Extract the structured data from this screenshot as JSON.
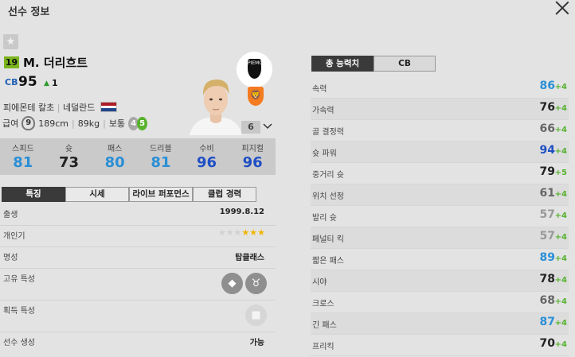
{
  "window": {
    "title": "선수 정보"
  },
  "player": {
    "number": "19",
    "name": "M. 더리흐트",
    "position": "CB",
    "ovr": "95",
    "ovr_change_icon": "▲",
    "ovr_change": "1",
    "club": "피에몬테 칼초",
    "divider": "|",
    "nation": "네덜란드",
    "salary_label": "급여",
    "salary": "9",
    "height": "189cm",
    "weight": "89kg",
    "body_type": "보통",
    "weak_foot_left": "4",
    "weak_foot_right": "5",
    "enhance_level": "6",
    "club_badge_text": "PIEMONTE",
    "nation_flag_colors": [
      "#ae1c28",
      "#ffffff",
      "#21468b"
    ]
  },
  "summary_stats": [
    {
      "label": "스피드",
      "value": "81",
      "color": "#2a8fd6"
    },
    {
      "label": "슛",
      "value": "73",
      "color": "#222222"
    },
    {
      "label": "패스",
      "value": "80",
      "color": "#2a8fd6"
    },
    {
      "label": "드리블",
      "value": "81",
      "color": "#2a8fd6"
    },
    {
      "label": "수비",
      "value": "96",
      "color": "#1f4fc4"
    },
    {
      "label": "피지컬",
      "value": "96",
      "color": "#1f4fc4"
    }
  ],
  "info_tabs": [
    "특징",
    "시세",
    "라이브 퍼포먼스",
    "클럽 경력"
  ],
  "details": {
    "birth_label": "출생",
    "birth": "1999.8.12",
    "popularity_label": "개인기",
    "stars_empty": "★★★",
    "stars_full": "★★★",
    "reputation_label": "명성",
    "reputation": "탑클래스",
    "unique_trait_label": "고유 특성",
    "acquired_trait_label": "획득 특성",
    "player_gen_label": "선수 생성",
    "player_gen": "가능"
  },
  "right_tabs": [
    "총 능력치",
    "CB"
  ],
  "attributes": [
    {
      "name": "속력",
      "value": "86",
      "bonus": "+4",
      "color": "#2a8fd6"
    },
    {
      "name": "가속력",
      "value": "76",
      "bonus": "+4",
      "color": "#222222"
    },
    {
      "name": "골 결정력",
      "value": "66",
      "bonus": "+4",
      "color": "#666666"
    },
    {
      "name": "슛 파워",
      "value": "94",
      "bonus": "+4",
      "color": "#1f4fc4"
    },
    {
      "name": "중거리 슛",
      "value": "79",
      "bonus": "+5",
      "color": "#222222"
    },
    {
      "name": "위치 선정",
      "value": "61",
      "bonus": "+4",
      "color": "#666666"
    },
    {
      "name": "발리 슛",
      "value": "57",
      "bonus": "+4",
      "color": "#999999"
    },
    {
      "name": "페널티 킥",
      "value": "57",
      "bonus": "+4",
      "color": "#999999"
    },
    {
      "name": "짧은 패스",
      "value": "89",
      "bonus": "+4",
      "color": "#2a8fd6"
    },
    {
      "name": "시야",
      "value": "78",
      "bonus": "+4",
      "color": "#222222"
    },
    {
      "name": "크로스",
      "value": "68",
      "bonus": "+4",
      "color": "#666666"
    },
    {
      "name": "긴 패스",
      "value": "87",
      "bonus": "+4",
      "color": "#2a8fd6"
    },
    {
      "name": "프리킥",
      "value": "70",
      "bonus": "+4",
      "color": "#222222"
    }
  ]
}
